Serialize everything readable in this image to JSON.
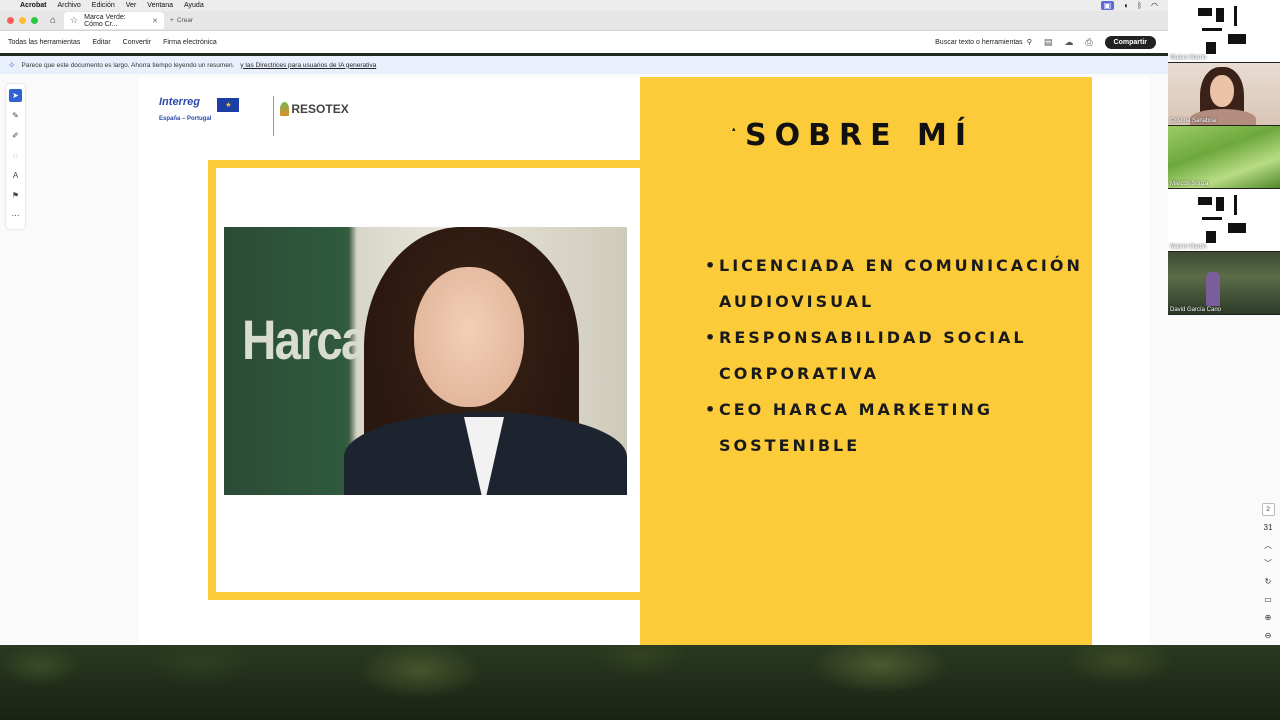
{
  "menubar": {
    "app": "Acrobat",
    "items": [
      "Archivo",
      "Edición",
      "Ver",
      "Ventana",
      "Ayuda"
    ]
  },
  "tabbar": {
    "tab_title": "Marca Verde: Cómo Cr...",
    "new_tab_label": "Crear"
  },
  "toolbar": {
    "items": [
      "Todas las herramientas",
      "Editar",
      "Convertir",
      "Firma electrónica"
    ],
    "search_label": "Buscar texto o herramientas",
    "share_label": "Compartir"
  },
  "banner": {
    "text": "Parece que este documento es largo. Ahorra tiempo leyendo un resumen.",
    "link": "y las Directrices para usuarios de IA generativa"
  },
  "slide": {
    "logo_interreg": "Interreg",
    "logo_interreg_sub": "España – Portugal",
    "logo_resotex": "RESOTEX",
    "photo_sign": "Harca",
    "title": "SOBRE MÍ",
    "bullets": [
      "LICENCIADA EN COMUNICACIÓN AUDIOVISUAL",
      "RESPONSABILIDAD SOCIAL CORPORATIVA",
      "CEO HARCA MARKETING SOSTENIBLE"
    ]
  },
  "page_nav": {
    "current_page": "2",
    "total_pages": "31"
  },
  "participants": [
    {
      "name": "Maleni Martín"
    },
    {
      "name": "Cristina Sanabria"
    },
    {
      "name": "Marcos Souza"
    },
    {
      "name": "Maleni Martín"
    },
    {
      "name": "David García Cano"
    }
  ],
  "colors": {
    "accent_yellow": "#fccb3a",
    "share_button": "#222222",
    "interreg_blue": "#2c4aa8"
  }
}
